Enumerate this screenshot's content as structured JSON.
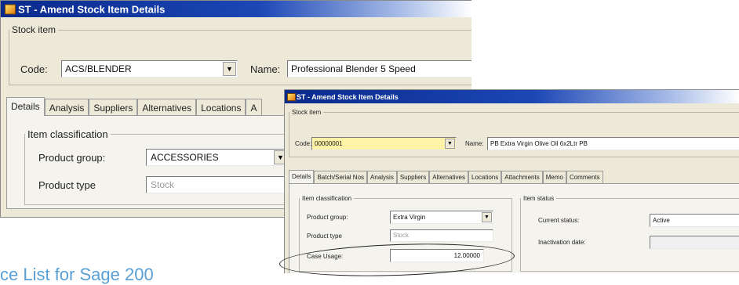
{
  "back_window": {
    "title": "ST - Amend Stock Item Details",
    "stock_item_legend": "Stock item",
    "code_label": "Code:",
    "code_value": "ACS/BLENDER",
    "name_label": "Name:",
    "name_value": "Professional Blender 5 Speed",
    "tabs": [
      "Details",
      "Analysis",
      "Suppliers",
      "Alternatives",
      "Locations",
      "A"
    ],
    "active_tab": "Details",
    "classification_legend": "Item classification",
    "product_group_label": "Product group:",
    "product_group_value": "ACCESSORIES",
    "product_type_label": "Product type",
    "product_type_value": "Stock"
  },
  "front_window": {
    "title": "ST - Amend Stock Item Details",
    "stock_item_legend": "Stock item",
    "code_label": "Code:",
    "code_value": "00000001",
    "name_label": "Name:",
    "name_value": "PB Extra Virgin Olive Oil 6x2Ltr PB",
    "tabs": [
      "Details",
      "Batch/Serial Nos",
      "Analysis",
      "Suppliers",
      "Alternatives",
      "Locations",
      "Attachments",
      "Memo",
      "Comments"
    ],
    "active_tab": "Details",
    "classification_legend": "Item classification",
    "product_group_label": "Product group:",
    "product_group_value": "Extra Virgin",
    "product_type_label": "Product type",
    "product_type_value": "Stock",
    "case_usage_label": "Case Usage:",
    "case_usage_value": "12.00000",
    "status_legend": "Item status",
    "current_status_label": "Current status:",
    "current_status_value": "Active",
    "inactivation_label": "Inactivation date:",
    "inactivation_value": ""
  },
  "caption": "ce List for Sage 200",
  "icons": {
    "window_icon": "stock-window-icon",
    "dropdown": "chevron-down-icon"
  },
  "colors": {
    "titlebar": "#0a2a8c",
    "caption": "#5a9fd4",
    "code_highlight": "#fff3a8"
  }
}
